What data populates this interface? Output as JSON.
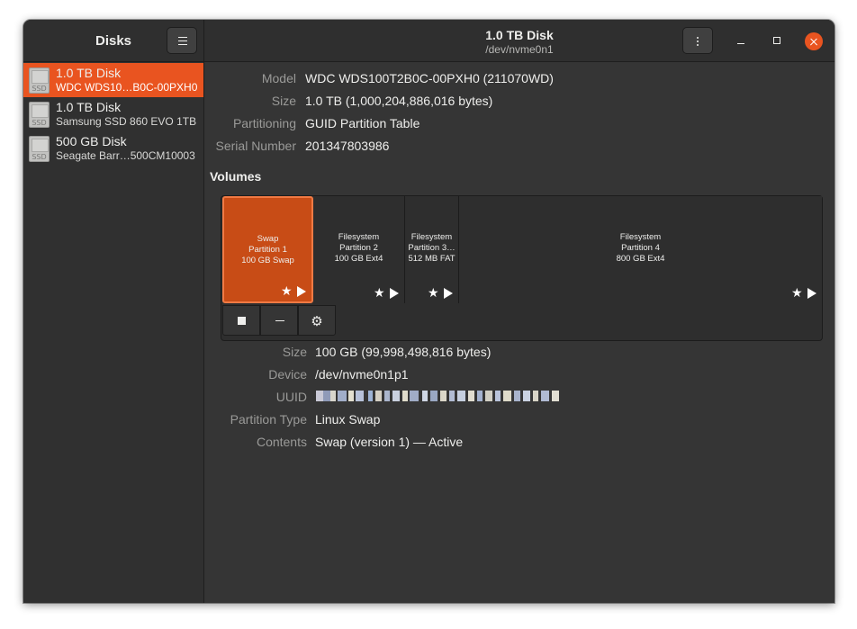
{
  "app": {
    "title": "Disks"
  },
  "window": {
    "title": "1.0 TB Disk",
    "subtitle": "/dev/nvme0n1"
  },
  "colors": {
    "accent": "#e95420",
    "background": "#353535",
    "selected_partition": "#c84c16"
  },
  "icons": {
    "menu": "hamburger-icon",
    "kebab": "vertical-dots-icon",
    "disk": "ssd-icon",
    "gear": "gear-icon"
  },
  "sidebar": {
    "items": [
      {
        "name": "1.0 TB Disk",
        "model": "WDC WDS10…B0C-00PXH0",
        "icon_label": "SSD"
      },
      {
        "name": "1.0 TB Disk",
        "model": "Samsung SSD 860 EVO 1TB",
        "icon_label": "SSD"
      },
      {
        "name": "500 GB Disk",
        "model": "Seagate Barr…500CM10003",
        "icon_label": "SSD"
      }
    ]
  },
  "disk_info": {
    "model_label": "Model",
    "model": "WDC WDS100T2B0C-00PXH0 (211070WD)",
    "size_label": "Size",
    "size": "1.0 TB (1,000,204,886,016 bytes)",
    "partitioning_label": "Partitioning",
    "partitioning": "GUID Partition Table",
    "serial_label": "Serial Number",
    "serial": "201347803986"
  },
  "volumes": {
    "heading": "Volumes",
    "partitions": [
      {
        "type": "Swap",
        "name": "Partition 1",
        "size": "100 GB Swap"
      },
      {
        "type": "Filesystem",
        "name": "Partition 2",
        "size": "100 GB Ext4"
      },
      {
        "type": "Filesystem",
        "name": "Partition 3…",
        "size": "512 MB FAT"
      },
      {
        "type": "Filesystem",
        "name": "Partition 4",
        "size": "800 GB Ext4"
      }
    ],
    "star": "★"
  },
  "partition_info": {
    "size_label": "Size",
    "size": "100 GB (99,998,498,816 bytes)",
    "device_label": "Device",
    "device": "/dev/nvme0n1p1",
    "uuid_label": "UUID",
    "type_label": "Partition Type",
    "type": "Linux Swap",
    "contents_label": "Contents",
    "contents": "Swap (version 1) — Active"
  }
}
